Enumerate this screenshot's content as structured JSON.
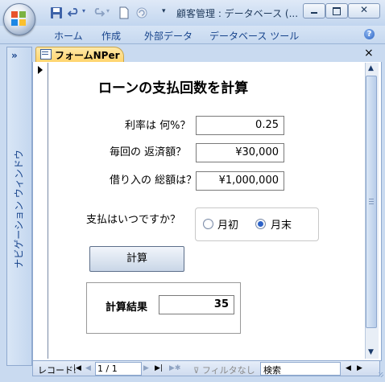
{
  "window": {
    "title": "顧客管理 : データベース (..."
  },
  "ribbon": {
    "tabs": [
      "ホーム",
      "作成",
      "外部データ",
      "データベース ツール"
    ],
    "help": "?"
  },
  "nav_pane": {
    "toggle": "»",
    "label": "ナビゲーション ウィンドウ"
  },
  "document": {
    "tab_label": "フォームNPer",
    "close": "×"
  },
  "form": {
    "title": "ローンの支払回数を計算",
    "fields": [
      {
        "label": "利率は 何%？",
        "value": "0.25"
      },
      {
        "label": "毎回の 返済額？",
        "value": "¥30,000"
      },
      {
        "label": "借り入の 総額は？",
        "value": "¥1,000,000"
      }
    ],
    "payment_timing": {
      "label": "支払はいつですか？",
      "options": [
        {
          "label": "月初",
          "selected": false
        },
        {
          "label": "月末",
          "selected": true
        }
      ]
    },
    "calc_button": "計算",
    "result": {
      "label": "計算結果",
      "value": "35"
    }
  },
  "record_nav": {
    "label": "レコード:",
    "position": "1 / 1",
    "filter": "フィルタなし",
    "search_placeholder": "検索"
  }
}
